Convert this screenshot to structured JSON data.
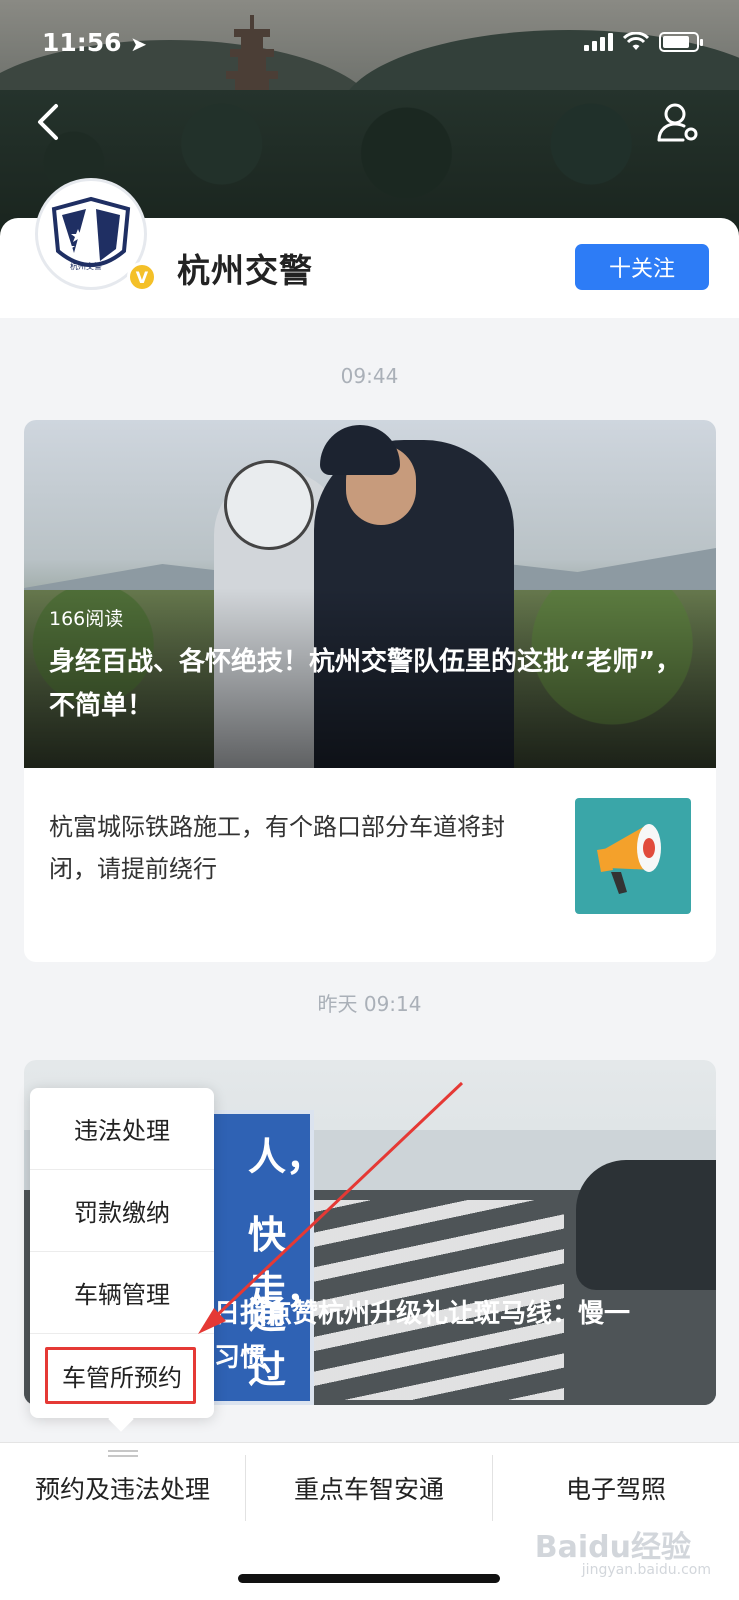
{
  "status_bar": {
    "time": "11:56"
  },
  "account": {
    "name": "杭州交警",
    "follow_label": "十关注",
    "avatar_text": "杭州交警"
  },
  "feed": {
    "timestamp_1": "09:44",
    "article_1": {
      "read_count": "166阅读",
      "title": "身经百战、各怀绝技！杭州交警队伍里的这批“老师”，不简单！"
    },
    "article_2": {
      "title": "杭富城际铁路施工，有个路口部分车道将封闭，请提前绕行"
    },
    "timestamp_2": "昨天 09:14",
    "article_3": {
      "title_line1": "日报点赞杭州升级礼让斑马线：慢一",
      "title_line2": "习惯",
      "sign_chars": [
        "人，",
        "快走，",
        "通过"
      ]
    }
  },
  "popup_menu": {
    "items": [
      "违法处理",
      "罚款缴纳",
      "车辆管理",
      "车管所预约"
    ]
  },
  "bottom_menu": {
    "tabs": [
      "预约及违法处理",
      "重点车智安通",
      "电子驾照"
    ]
  },
  "watermark": {
    "main": "Baidu经验",
    "sub": "jingyan.baidu.com"
  },
  "colors": {
    "accent": "#2d7cf6",
    "highlight": "#e53935",
    "verified": "#f4c028"
  }
}
